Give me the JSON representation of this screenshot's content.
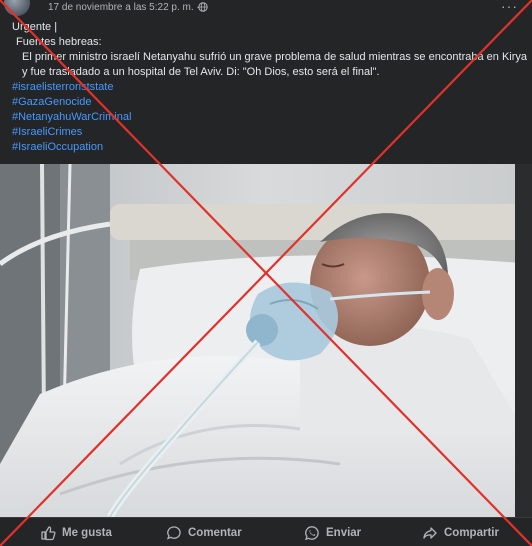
{
  "post": {
    "timestamp": "17 de noviembre a las 5:22 p. m. ·",
    "more": "···",
    "lines": [
      "Urgente |",
      "Fuentes hebreas:",
      "El primer ministro israelí Netanyahu sufrió un grave problema de salud mientras se encontraba en Kirya y fue trasladado a un hospital de Tel Aviv.  Di: \"Oh Dios, esto será el final\"."
    ],
    "hashtags": [
      "#israelisterroriststate",
      "#GazaGenocide",
      "#NetanyahuWarCriminal",
      "#IsraeliCrimes",
      "#IsraeliOccupation"
    ]
  },
  "actions": {
    "like": "Me gusta",
    "comment": "Comentar",
    "send": "Enviar",
    "share": "Compartir"
  },
  "colors": {
    "hashtag": "#4599ff",
    "overlay_x": "#e0322b",
    "background": "#242526",
    "text": "#e4e6eb"
  },
  "icons": [
    "globe-icon",
    "more-icon",
    "like-icon",
    "comment-icon",
    "whatsapp-icon",
    "share-icon"
  ]
}
